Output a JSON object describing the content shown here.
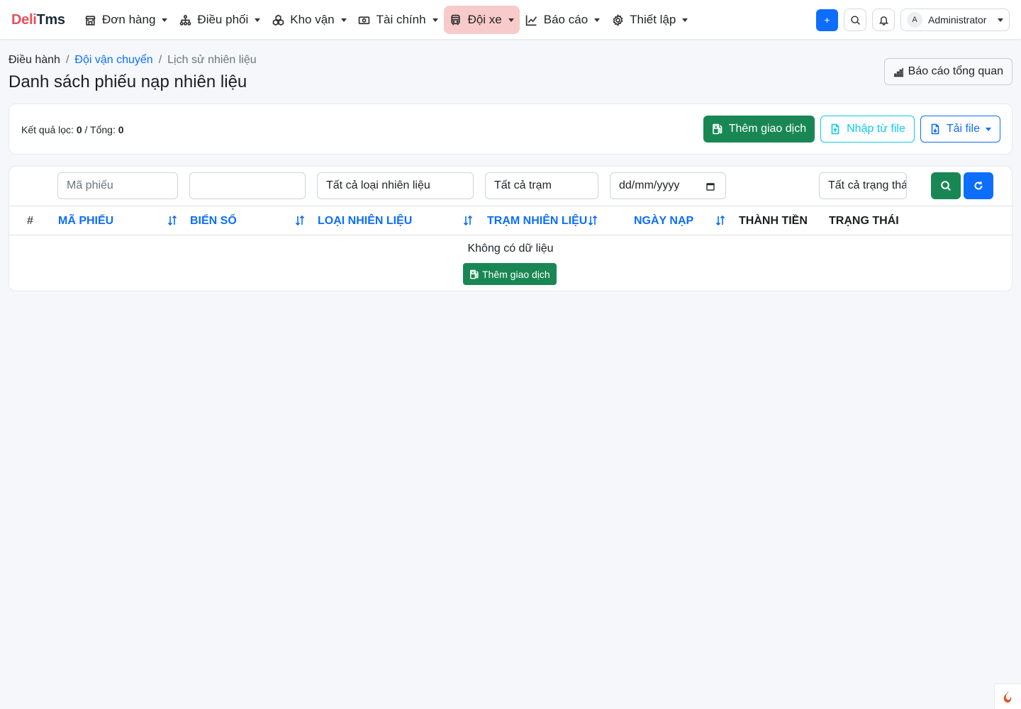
{
  "brand": {
    "part1": "Deli",
    "part2": "Tms"
  },
  "nav": {
    "items": [
      {
        "label": "Đơn hàng",
        "icon": "store-icon"
      },
      {
        "label": "Điều phối",
        "icon": "hierarchy-icon"
      },
      {
        "label": "Kho vận",
        "icon": "boxes-icon"
      },
      {
        "label": "Tài chính",
        "icon": "cash-icon"
      },
      {
        "label": "Đội xe",
        "icon": "bus-icon",
        "active": true
      },
      {
        "label": "Báo cáo",
        "icon": "chart-line-icon"
      },
      {
        "label": "Thiết lập",
        "icon": "gear-icon"
      }
    ],
    "plus_label": "+",
    "user": {
      "avatar_letter": "A",
      "name": "Administrator"
    }
  },
  "breadcrumb": {
    "root": "Điều hành",
    "parent": "Đội vận chuyển",
    "current": "Lịch sử nhiên liệu",
    "separator": "/"
  },
  "page_title": "Danh sách phiếu nạp nhiên liệu",
  "report_button": "Báo cáo tổng quan",
  "summary": {
    "filtered_label": "Kết quả lọc:",
    "filtered_value": "0",
    "total_label": "Tổng:",
    "total_value": "0",
    "divider": "/"
  },
  "actions": {
    "add": "Thêm giao dịch",
    "import": "Nhập từ file",
    "download": "Tải file"
  },
  "filters": {
    "code_placeholder": "Mã phiếu",
    "plate_value": "",
    "fuel_type": "Tất cả loại nhiên liệu",
    "station": "Tất cả trạm",
    "date_placeholder": "dd/mm/yyyy",
    "status": "Tất cả trạng thái"
  },
  "table": {
    "headers": {
      "index": "#",
      "code": "MÃ PHIẾU",
      "plate": "BIỂN SỐ",
      "fuel_type": "LOẠI NHIÊN LIỆU",
      "station": "TRẠM NHIÊN LIỆU",
      "date": "NGÀY NẠP",
      "amount": "THÀNH TIỀN",
      "status": "TRẠNG THÁI"
    },
    "empty_text": "Không có dữ liệu",
    "empty_action": "Thêm giao dịch",
    "rows": []
  },
  "colors": {
    "primary": "#0d6efd",
    "success": "#198754",
    "info": "#0dcaf0",
    "brand_red": "#e8505b",
    "active_nav": "#f8caca"
  }
}
